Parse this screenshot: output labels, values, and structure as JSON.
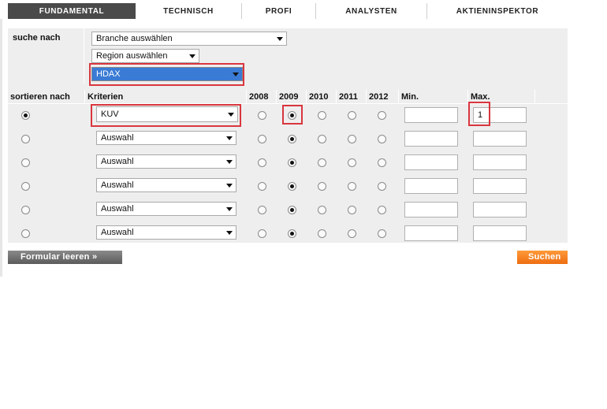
{
  "tabs": [
    {
      "label": "FUNDAMENTAL",
      "active": true
    },
    {
      "label": "TECHNISCH",
      "active": false
    },
    {
      "label": "PROFI",
      "active": false
    },
    {
      "label": "ANALYSTEN",
      "active": false
    },
    {
      "label": "AKTIENINSPEKTOR",
      "active": false
    }
  ],
  "search": {
    "label": "suche nach",
    "branche": "Branche auswählen",
    "region": "Region auswählen",
    "index": "HDAX"
  },
  "table": {
    "sort_label": "sortieren nach",
    "criteria_label": "Kriterien",
    "years": [
      "2008",
      "2009",
      "2010",
      "2011",
      "2012"
    ],
    "min_label": "Min.",
    "max_label": "Max.",
    "rows": [
      {
        "sort_selected": true,
        "criterion": "KUV",
        "year_selected": "2009",
        "min": "",
        "max": "1"
      },
      {
        "sort_selected": false,
        "criterion": "Auswahl",
        "year_selected": "2009",
        "min": "",
        "max": ""
      },
      {
        "sort_selected": false,
        "criterion": "Auswahl",
        "year_selected": "2009",
        "min": "",
        "max": ""
      },
      {
        "sort_selected": false,
        "criterion": "Auswahl",
        "year_selected": "2009",
        "min": "",
        "max": ""
      },
      {
        "sort_selected": false,
        "criterion": "Auswahl",
        "year_selected": "2009",
        "min": "",
        "max": ""
      },
      {
        "sort_selected": false,
        "criterion": "Auswahl",
        "year_selected": "2009",
        "min": "",
        "max": ""
      }
    ]
  },
  "buttons": {
    "clear": "Formular leeren »",
    "search": "Suchen"
  },
  "colors": {
    "highlight": "#d9363e",
    "selection_blue": "#3a7bd5",
    "search_orange": "#f07a1c",
    "tab_active": "#4a4a4a"
  }
}
